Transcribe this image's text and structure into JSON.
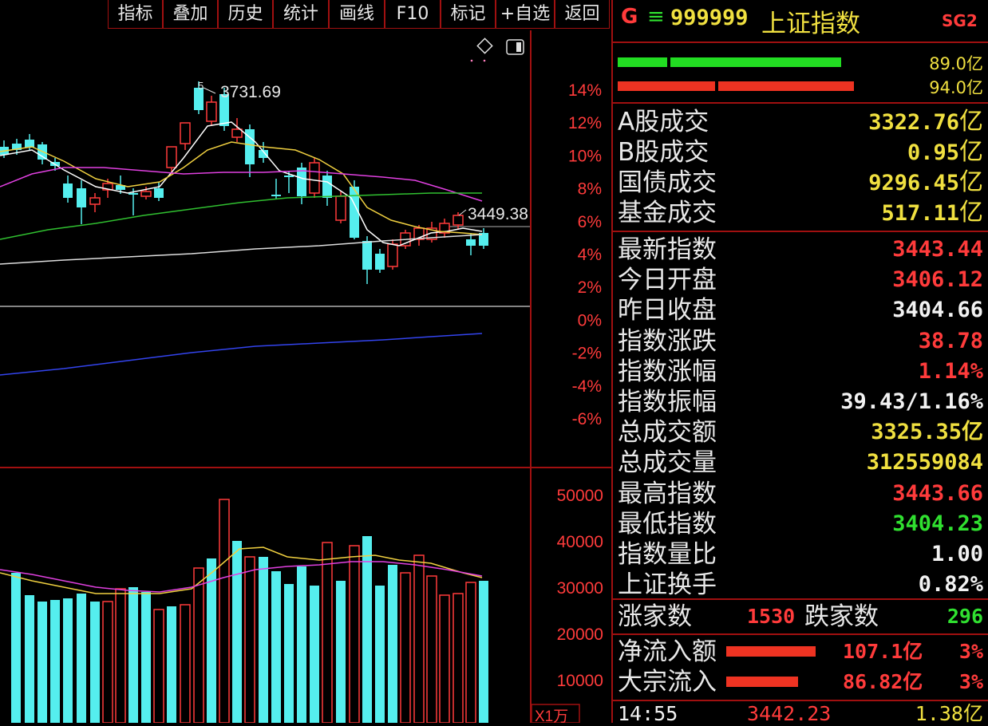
{
  "toolbar": {
    "buttons": [
      "指标",
      "叠加",
      "历史",
      "统计",
      "画线",
      "F10",
      "标记",
      "+自选",
      "返回"
    ]
  },
  "chart": {
    "high_label": "3731.69",
    "last_label": "3449.38",
    "pct_ticks": [
      "14%",
      "12%",
      "10%",
      "8%",
      "6%",
      "4%",
      "2%",
      "0%",
      "-2%",
      "-4%",
      "-6%"
    ],
    "vol_ticks": [
      "50000",
      "40000",
      "30000",
      "20000",
      "10000"
    ],
    "vol_unit": "X1万",
    "icons": [
      "diamond-icon",
      "panel-toggle-icon"
    ]
  },
  "header": {
    "g": "G",
    "menu": "≡",
    "code": "999999",
    "name": "上证指数",
    "tag": "SG2"
  },
  "flow_bars": {
    "buy_label": "89.0亿",
    "sell_label": "94.0亿",
    "buy_color": "#22dd22",
    "sell_color": "#ee3322"
  },
  "turnover": [
    {
      "label": "A股成交",
      "value": "3322.76",
      "unit": "亿",
      "color": "yellow"
    },
    {
      "label": "B股成交",
      "value": "0.95",
      "unit": "亿",
      "color": "yellow"
    },
    {
      "label": "国债成交",
      "value": "9296.45",
      "unit": "亿",
      "color": "yellow"
    },
    {
      "label": "基金成交",
      "value": "517.11",
      "unit": "亿",
      "color": "yellow"
    }
  ],
  "stats": [
    {
      "label": "最新指数",
      "value": "3443.44",
      "color": "red"
    },
    {
      "label": "今日开盘",
      "value": "3406.12",
      "color": "red"
    },
    {
      "label": "昨日收盘",
      "value": "3404.66",
      "color": "white"
    },
    {
      "label": "指数涨跌",
      "value": "38.78",
      "color": "red"
    },
    {
      "label": "指数涨幅",
      "value": "1.14%",
      "color": "red"
    },
    {
      "label": "指数振幅",
      "value": "39.43/1.16%",
      "color": "white"
    },
    {
      "label": "总成交额",
      "value": "3325.35亿",
      "color": "yellow"
    },
    {
      "label": "总成交量",
      "value": "312559084",
      "color": "yellow"
    },
    {
      "label": "最高指数",
      "value": "3443.66",
      "color": "red"
    },
    {
      "label": "最低指数",
      "value": "3404.23",
      "color": "green"
    },
    {
      "label": "指数量比",
      "value": "1.00",
      "color": "white"
    },
    {
      "label": "上证换手",
      "value": "0.82%",
      "color": "white"
    }
  ],
  "breadth": {
    "up_label": "涨家数",
    "up_value": "1530",
    "down_label": "跌家数",
    "down_value": "296"
  },
  "flows": [
    {
      "label": "净流入额",
      "value": "107.1亿",
      "pct": "3%"
    },
    {
      "label": "大宗流入",
      "value": "86.82亿",
      "pct": "3%"
    }
  ],
  "tick": {
    "time": "14:55",
    "price": "3442.23",
    "amount": "1.38亿"
  },
  "colors": {
    "up": "#ff3b3b",
    "down": "#55eeee",
    "grid": "#a01010",
    "ma5": "#ffffff",
    "ma10": "#f0d040",
    "ma20": "#e040e0",
    "ma60": "#30c030",
    "ma120": "#dddddd",
    "ma250": "#3344ee"
  }
}
